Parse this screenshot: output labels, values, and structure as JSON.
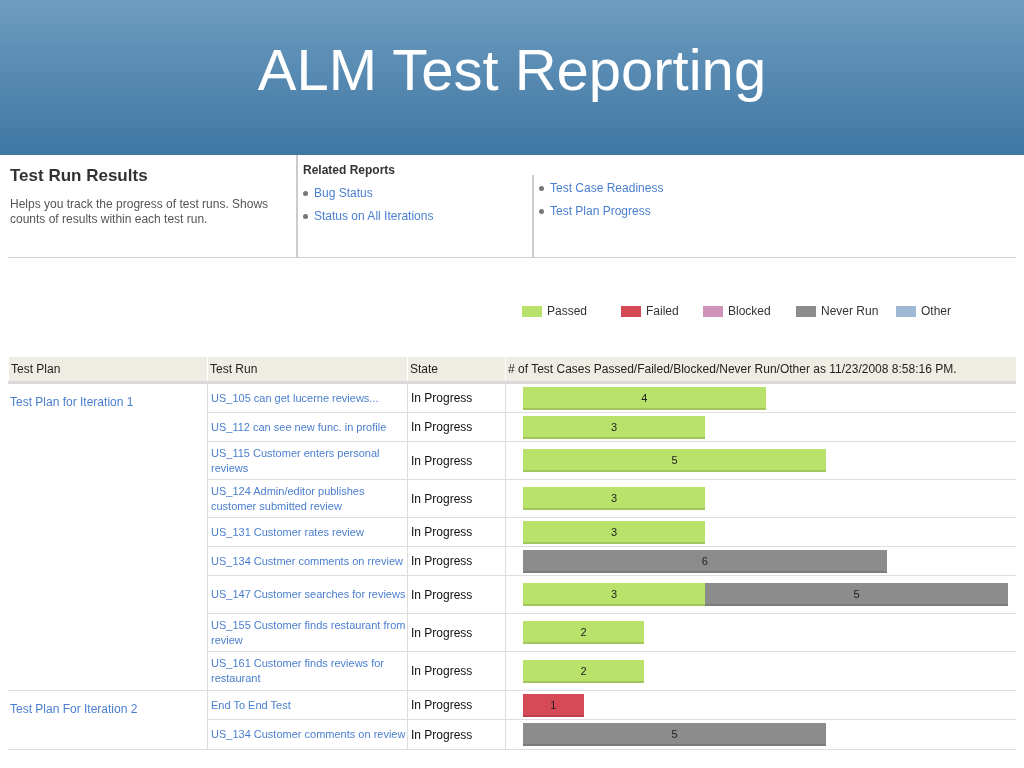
{
  "slide_title": "ALM Test Reporting",
  "report": {
    "title": "Test Run Results",
    "description": "Helps you track the progress of test runs. Shows counts of results within each test run.",
    "related_reports": {
      "heading": "Related Reports",
      "columns": [
        [
          "Bug Status",
          "Status on All Iterations"
        ],
        [
          "Test Case Readiness",
          "Test Plan Progress"
        ]
      ]
    }
  },
  "legend": [
    {
      "label": "Passed",
      "kind": "passed",
      "color": "#b9e26a"
    },
    {
      "label": "Failed",
      "kind": "failed",
      "color": "#d64a57"
    },
    {
      "label": "Blocked",
      "kind": "blocked",
      "color": "#cf93ba"
    },
    {
      "label": "Never Run",
      "kind": "never_run",
      "color": "#8c8c8c"
    },
    {
      "label": "Other",
      "kind": "other",
      "color": "#9db9d3"
    }
  ],
  "table": {
    "columns": [
      "Test Plan",
      "Test Run",
      "State",
      "# of Test Cases Passed/Failed/Blocked/Never Run/Other as 11/23/2008 8:58:16 PM."
    ],
    "groups": [
      {
        "test_plan": "Test Plan for Iteration 1",
        "rows": [
          {
            "test_run": "US_105 can get lucerne reviews...",
            "state": "In Progress",
            "segments": [
              {
                "kind": "passed",
                "count": "4"
              }
            ]
          },
          {
            "test_run": "US_112 can see new func. in profile",
            "state": "In Progress",
            "segments": [
              {
                "kind": "passed",
                "count": "3"
              }
            ]
          },
          {
            "test_run": "US_115 Customer enters personal reviews",
            "state": "In Progress",
            "segments": [
              {
                "kind": "passed",
                "count": "5"
              }
            ]
          },
          {
            "test_run": "US_124 Admin/editor publishes customer submitted review",
            "state": "In Progress",
            "segments": [
              {
                "kind": "passed",
                "count": "3"
              }
            ]
          },
          {
            "test_run": "US_131 Customer rates review",
            "state": "In Progress",
            "segments": [
              {
                "kind": "passed",
                "count": "3"
              }
            ]
          },
          {
            "test_run": "US_134 Custmer comments on rreview",
            "state": "In Progress",
            "segments": [
              {
                "kind": "never_run",
                "count": "6"
              }
            ]
          },
          {
            "test_run": "US_147 Customer searches for reviews",
            "state": "In Progress",
            "segments": [
              {
                "kind": "passed",
                "count": "3"
              },
              {
                "kind": "never_run",
                "count": "5"
              }
            ]
          },
          {
            "test_run": "US_155 Customer finds restaurant from review",
            "state": "In Progress",
            "segments": [
              {
                "kind": "passed",
                "count": "2"
              }
            ]
          },
          {
            "test_run": "US_161 Customer finds reviews for restaurant",
            "state": "In Progress",
            "segments": [
              {
                "kind": "passed",
                "count": "2"
              }
            ]
          }
        ]
      },
      {
        "test_plan": "Test Plan For Iteration 2",
        "rows": [
          {
            "test_run": "End To End Test",
            "state": "In Progress",
            "segments": [
              {
                "kind": "failed",
                "count": "1"
              }
            ]
          },
          {
            "test_run": "US_134 Customer comments on review",
            "state": "In Progress",
            "segments": [
              {
                "kind": "never_run",
                "count": "5"
              }
            ]
          }
        ]
      }
    ]
  }
}
